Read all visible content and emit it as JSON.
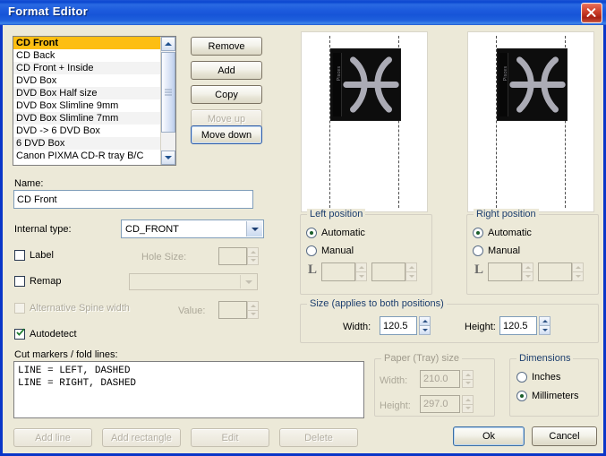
{
  "window": {
    "title": "Format Editor",
    "close_label": "Close",
    "accent_titlebar": "#1b54d6",
    "face_color": "#ece9d8",
    "selection_color": "#fdbe12"
  },
  "format_list": {
    "items": [
      "CD Front",
      "CD Back",
      "CD Front + Inside",
      "DVD Box",
      "DVD Box Half size",
      "DVD Box Slimline 9mm",
      "DVD Box Slimline 7mm",
      "DVD -> 6 DVD Box",
      "6 DVD Box",
      "Canon PIXMA CD-R tray B/C"
    ],
    "selected_index": 0
  },
  "list_buttons": [
    {
      "label": "Remove",
      "enabled": true,
      "focused": false
    },
    {
      "label": "Add",
      "enabled": true,
      "focused": false
    },
    {
      "label": "Copy",
      "enabled": true,
      "focused": false
    },
    {
      "label": "Move up",
      "enabled": false,
      "focused": false
    },
    {
      "label": "Move down",
      "enabled": true,
      "focused": true
    }
  ],
  "name_field": {
    "label": "Name:",
    "value": "CD Front"
  },
  "internal_type": {
    "label": "Internal type:",
    "value": "CD_FRONT",
    "arrow_icon": "chevron-down-icon"
  },
  "options": {
    "label_checkbox": {
      "label": "Label",
      "checked": false,
      "enabled": true
    },
    "remap_checkbox": {
      "label": "Remap",
      "checked": false,
      "enabled": true
    },
    "alt_spine_checkbox": {
      "label": "Alternative Spine width",
      "checked": false,
      "enabled": false
    },
    "autodetect_checkbox": {
      "label": "Autodetect",
      "checked": true,
      "enabled": true
    },
    "hole_size": {
      "label": "Hole Size:",
      "value": "",
      "enabled": false
    },
    "remap_combo": {
      "value": "",
      "enabled": false
    },
    "value_field": {
      "label": "Value:",
      "value": "",
      "enabled": false
    }
  },
  "cut_markers": {
    "label": "Cut markers / fold lines:",
    "text": "LINE = LEFT, DASHED\nLINE = RIGHT, DASHED"
  },
  "cut_buttons": [
    {
      "label": "Add line",
      "enabled": false
    },
    {
      "label": "Add rectangle",
      "enabled": false
    },
    {
      "label": "Edit",
      "enabled": false
    },
    {
      "label": "Delete",
      "enabled": false
    }
  ],
  "previews": {
    "left": {
      "name": "left-preview",
      "art_caption": "Pisces"
    },
    "right": {
      "name": "right-preview",
      "art_caption": "Pisces"
    }
  },
  "left_position": {
    "title": "Left position",
    "automatic": {
      "label": "Automatic",
      "selected": true
    },
    "manual": {
      "label": "Manual",
      "selected": false
    },
    "marker": "L",
    "x_value": "",
    "y_value": ""
  },
  "right_position": {
    "title": "Right position",
    "automatic": {
      "label": "Automatic",
      "selected": true
    },
    "manual": {
      "label": "Manual",
      "selected": false
    },
    "marker": "L",
    "x_value": "",
    "y_value": ""
  },
  "size_group": {
    "title": "Size (applies to both positions)",
    "width_label": "Width:",
    "width_value": "120.5",
    "height_label": "Height:",
    "height_value": "120.5"
  },
  "paper_group": {
    "title": "Paper (Tray) size",
    "width_label": "Width:",
    "width_value": "210.0",
    "height_label": "Height:",
    "height_value": "297.0",
    "enabled": false
  },
  "dimensions_group": {
    "title": "Dimensions",
    "inches": {
      "label": "Inches",
      "selected": false
    },
    "millimeters": {
      "label": "Millimeters",
      "selected": true
    }
  },
  "dialog_buttons": {
    "ok": {
      "label": "Ok",
      "default": true
    },
    "cancel": {
      "label": "Cancel",
      "default": false
    }
  }
}
